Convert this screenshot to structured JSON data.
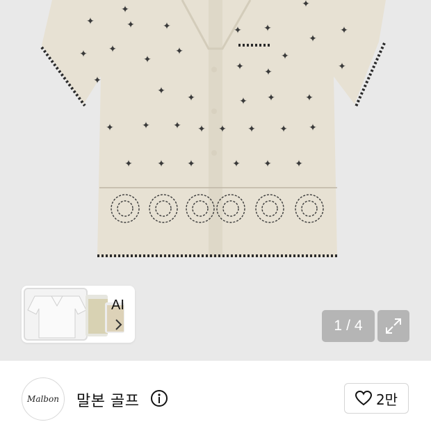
{
  "gallery": {
    "counter_current": "1",
    "counter_separator": "/",
    "counter_total": "4",
    "ai_label": "AI"
  },
  "brand": {
    "logo_text": "Malbon",
    "name": "말본 골프",
    "like_count": "2만"
  },
  "colors": {
    "gallery_bg": "#e9e9e9",
    "shirt": "#e7e1d3",
    "stitch": "#2a2a2a",
    "overlay_button": "#b5b5b5"
  },
  "icons": [
    "chevron-right-icon",
    "expand-icon",
    "info-icon",
    "heart-icon"
  ]
}
